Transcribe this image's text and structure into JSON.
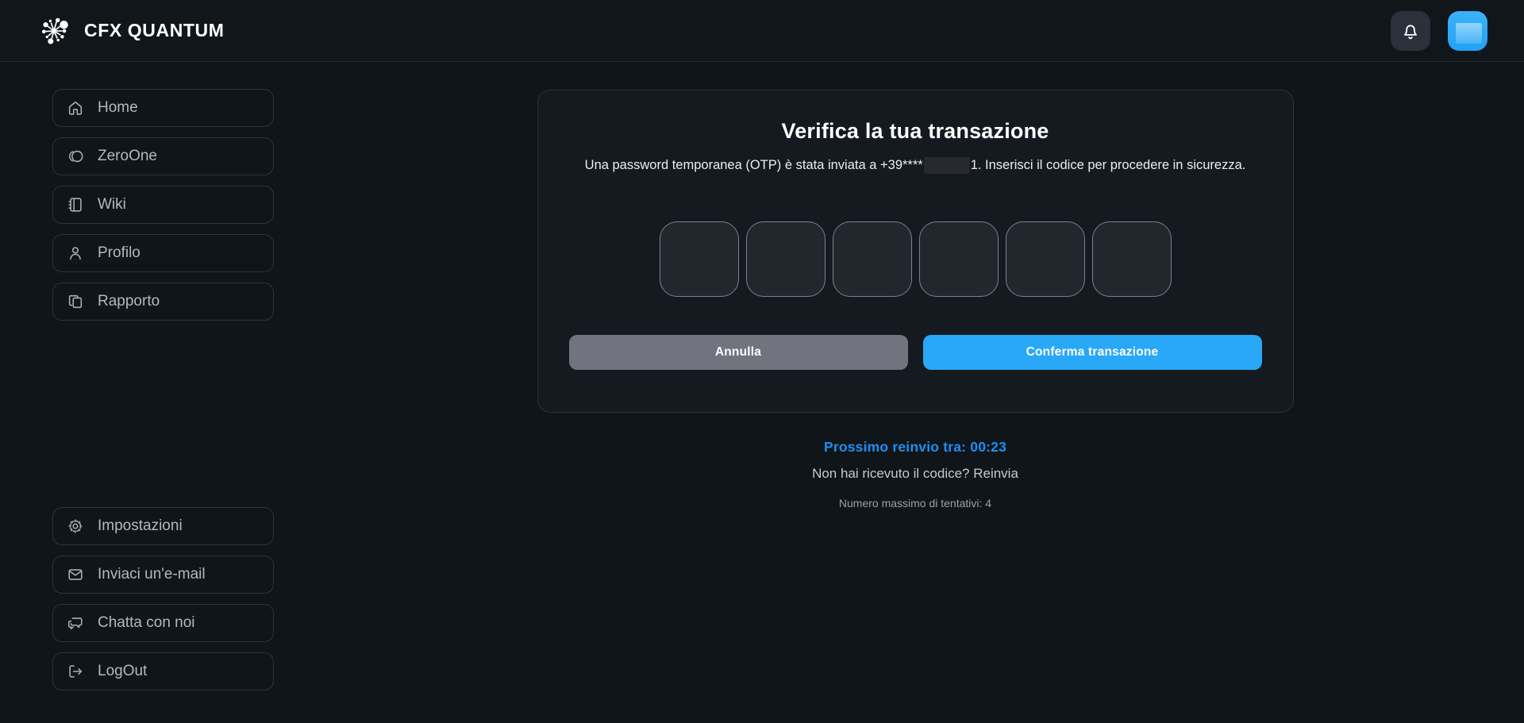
{
  "header": {
    "brand": "CFX QUANTUM"
  },
  "sidebar": {
    "top_items": [
      {
        "label": "Home"
      },
      {
        "label": "ZeroOne"
      },
      {
        "label": "Wiki"
      },
      {
        "label": "Profilo"
      },
      {
        "label": "Rapporto"
      }
    ],
    "bottom_items": [
      {
        "label": "Impostazioni"
      },
      {
        "label": "Inviaci un'e-mail"
      },
      {
        "label": "Chatta con noi"
      },
      {
        "label": "LogOut"
      }
    ]
  },
  "otp_card": {
    "title": "Verifica la tua transazione",
    "description_prefix": "Una password temporanea (OTP) è stata inviata a +39****",
    "description_redacted": true,
    "description_suffix": "1. Inserisci il codice per procedere in sicurezza.",
    "digit_count": 6,
    "digits": [
      "",
      "",
      "",
      "",
      "",
      ""
    ],
    "cancel_label": "Annulla",
    "confirm_label": "Conferma transazione"
  },
  "resend": {
    "countdown_text": "Prossimo reinvio tra: 00:23",
    "resend_text": "Non hai ricevuto il codice? Reinvia",
    "max_attempts_text": "Numero massimo di tentativi: 4"
  },
  "colors": {
    "accent_blue": "#29a8f7",
    "link_blue": "#1e8ff2",
    "cancel_gray": "#71747f",
    "page_bg": "#0f1519",
    "card_bg": "#141a1f"
  }
}
